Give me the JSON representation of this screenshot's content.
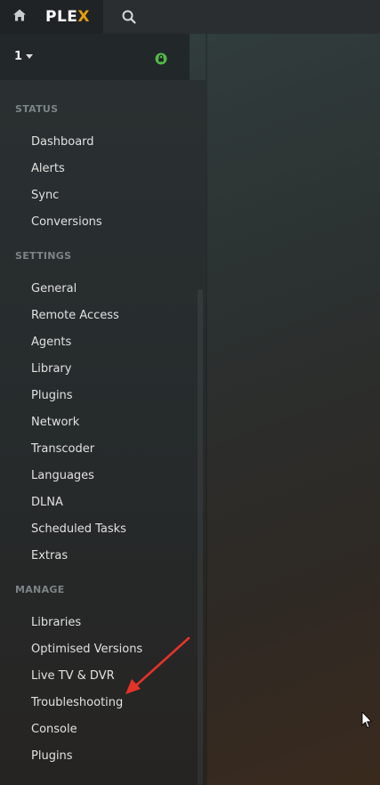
{
  "app": {
    "logo_main": "PLE",
    "logo_accent": "X"
  },
  "server": {
    "name": "1"
  },
  "sidebar": {
    "status_header": "STATUS",
    "status_items": [
      "Dashboard",
      "Alerts",
      "Sync",
      "Conversions"
    ],
    "settings_header": "SETTINGS",
    "settings_items": [
      "General",
      "Remote Access",
      "Agents",
      "Library",
      "Plugins",
      "Network",
      "Transcoder",
      "Languages",
      "DLNA",
      "Scheduled Tasks",
      "Extras"
    ],
    "manage_header": "MANAGE",
    "manage_items": [
      "Libraries",
      "Optimised Versions",
      "Live TV & DVR",
      "Troubleshooting",
      "Console",
      "Plugins"
    ]
  },
  "icons": {
    "home": "home-icon",
    "search": "search-icon",
    "lock": "lock-icon",
    "caret": "caret-down-icon"
  },
  "colors": {
    "brand_accent": "#e5a00d",
    "lock_green": "#53b949",
    "annotation_arrow": "#e5332a"
  }
}
